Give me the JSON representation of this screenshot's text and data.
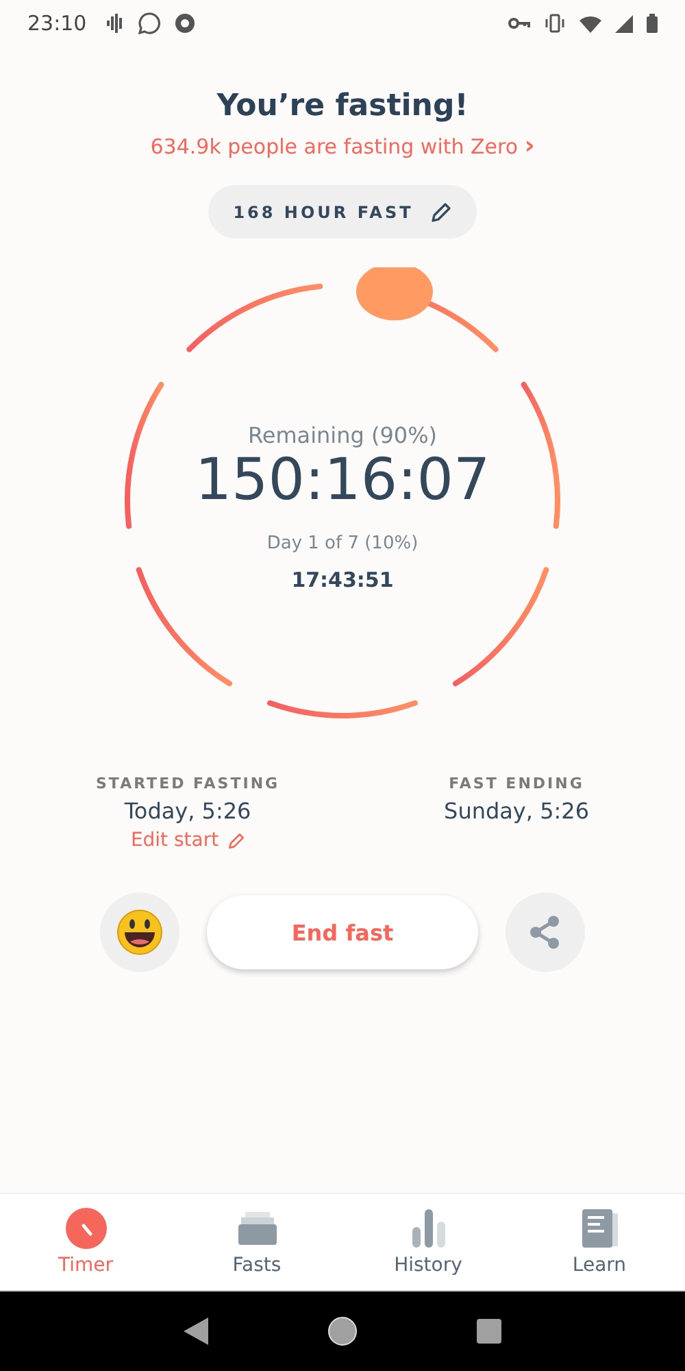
{
  "status_bar": {
    "time": "23:10"
  },
  "header": {
    "title": "You’re fasting!",
    "community_link": "634.9k people are fasting with Zero",
    "chevron": "›"
  },
  "fast_type": {
    "label": "168 HOUR FAST"
  },
  "timer": {
    "remaining_label": "Remaining (90%)",
    "remaining": "150:16:07",
    "day_label": "Day 1 of 7 (10%)",
    "elapsed": "17:43:51"
  },
  "times": [
    {
      "label": "STARTED FASTING",
      "value": "Today, 5:26",
      "edit": "Edit start"
    },
    {
      "label": "FAST ENDING",
      "value": "Sunday, 5:26"
    }
  ],
  "actions": {
    "end_button": "End fast"
  },
  "tabs": [
    {
      "label": "Timer",
      "kind": "timer",
      "selected": true
    },
    {
      "label": "Fasts",
      "kind": "fasts",
      "selected": false
    },
    {
      "label": "History",
      "kind": "history",
      "selected": false
    },
    {
      "label": "Learn",
      "kind": "learn",
      "selected": false
    }
  ]
}
